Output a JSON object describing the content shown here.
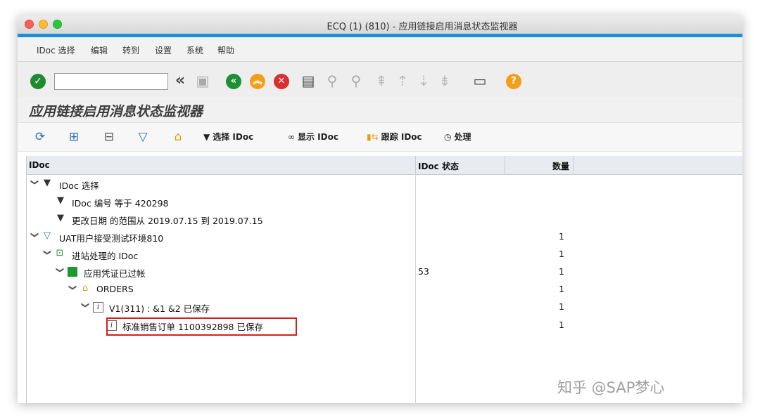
{
  "window": {
    "title": "ECQ (1) (810) - 应用链接启用消息状态监视器"
  },
  "menu": [
    "IDoc 选择",
    "编辑",
    "转到",
    "设置",
    "系统",
    "帮助"
  ],
  "toolbar": {
    "command_value": "",
    "expand_glyph": "«"
  },
  "app": {
    "title": "应用链接启用消息状态监视器",
    "buttons": {
      "select_idoc": "选择 IDoc",
      "display_idoc": "显示 IDoc",
      "trace_idoc": "跟踪 IDoc",
      "process": "处理"
    }
  },
  "table": {
    "headers": {
      "idoc": "IDoc",
      "status": "IDoc 状态",
      "count": "数量"
    },
    "rows": [
      {
        "label": "IDoc 选择",
        "status": "",
        "count": ""
      },
      {
        "label": "IDoc 编号 等于 420298",
        "status": "",
        "count": ""
      },
      {
        "label": "更改日期 的范围从 2019.07.15 到 2019.07.15",
        "status": "",
        "count": ""
      },
      {
        "label": "UAT用户接受测试环境810",
        "status": "",
        "count": "1"
      },
      {
        "label": "进站处理的 IDoc",
        "status": "",
        "count": "1"
      },
      {
        "label": "应用凭证已过帐",
        "status": "53",
        "count": "1"
      },
      {
        "label": "ORDERS",
        "status": "",
        "count": "1"
      },
      {
        "label": "V1(311) : &1 &2 已保存",
        "status": "",
        "count": "1"
      },
      {
        "label": "标准销售订单 1100392898 已保存",
        "status": "",
        "count": "1"
      }
    ]
  },
  "watermark": "知乎 @SAP梦心",
  "colors": {
    "accent_blue": "#1a8fd8",
    "highlight_red": "#d4201c",
    "status_green": "#1a9a2f"
  }
}
